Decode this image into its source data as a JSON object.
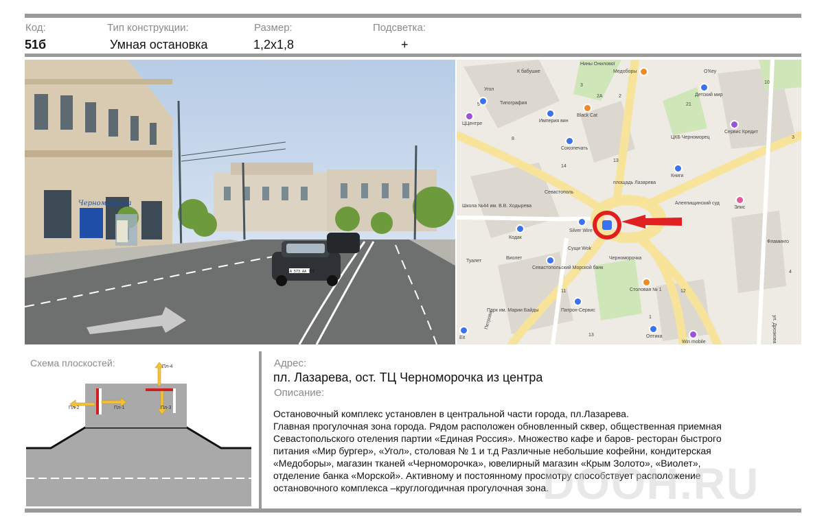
{
  "header": {
    "code_label": "Код:",
    "code_value": "51б",
    "type_label": "Тип конструкции:",
    "type_value": "Умная остановка",
    "size_label": "Размер:",
    "size_value": "1,2х1,8",
    "light_label": "Подсветка:",
    "light_value": "+"
  },
  "photo": {
    "storefront_sign": "Черноморочка",
    "plate": "А 573 АА 777"
  },
  "map": {
    "labels": [
      "Нины Онилової",
      "К бабушке",
      "Медоборы",
      "О'Кеу",
      "Угол",
      "Типография",
      "Детский мир",
      "ЦЦентре",
      "Империя вин",
      "Black Cat",
      "Союзпечать",
      "ЦКБ Черноморец",
      "Сервис Кредит",
      "Книги",
      "площадь Лазарева",
      "Севастополь",
      "Школа №44 им. В.В. Ходырева",
      "Алеппищинский суд",
      "Элис",
      "Silver Wire",
      "Кодак",
      "Сущи Wok",
      "Черноморочка",
      "Виолет",
      "Туалет",
      "Севастопольский Морской банк",
      "Столовая № 1",
      "Патрон-Сервис",
      "Парк им. Марии Байды",
      "Оптика",
      "Win mobile",
      "Eit",
      "Петрова",
      "ул. Дрозкова",
      "Фламинго"
    ],
    "numbers": [
      "3",
      "2А",
      "2",
      "10",
      "5",
      "8",
      "21",
      "14",
      "13",
      "11",
      "12",
      "1",
      "4",
      "3",
      "13"
    ]
  },
  "schema": {
    "label": "Схема плоскостей:",
    "planes": [
      "Пл-1",
      "Пл-2",
      "Пл-3",
      "Пл-4"
    ]
  },
  "address": {
    "label": "Адрес:",
    "value": "пл. Лазарева, ост. ТЦ Черноморочка из центра"
  },
  "description": {
    "label": "Описание:",
    "lines": [
      "Остановочный комплекс установлен в центральной части города, пл.Лазарева.",
      "Главная прогулочная зона города. Рядом расположен обновленный сквер, общественная приемная",
      "Севастопольского отеления партии «Единая Россия». Множество кафе и баров- ресторан быстрого",
      "питания «Мир бургер», «Угол», столовая № 1 и т.д Различные небольшие кофейни, кондитерская",
      "«Медоборы», магазин тканей «Черноморочка», ювелирный магазин «Крым Золото», «Виолет»,",
      "отделение банка «Морской». Активному и постоянному просмотру способствует расположение",
      "остановочного комплекса –круглогодичная  прогулочная зона."
    ]
  },
  "watermark": "DOOH.RU",
  "colors": {
    "rule": "#9a9a9a",
    "label": "#8a8a8a",
    "marker": "#e02020",
    "plane": "#cc2020",
    "arrow": "#f2c23a"
  }
}
